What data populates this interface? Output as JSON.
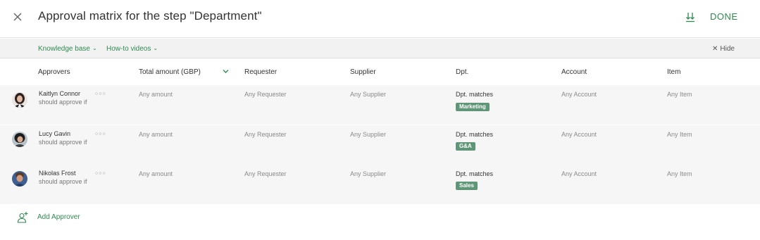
{
  "header": {
    "title": "Approval matrix for the step \"Department\"",
    "done_label": "DONE"
  },
  "helpbar": {
    "knowledge_base": "Knowledge base",
    "howto_videos": "How-to videos",
    "hide_label": "Hide"
  },
  "columns": [
    "Approvers",
    "Total amount (GBP)",
    "Requester",
    "Supplier",
    "Dpt.",
    "Account",
    "Item"
  ],
  "rows": [
    {
      "name": "Kaitlyn Connor",
      "sub": "should approve if",
      "amount": "Any amount",
      "requester": "Any Requester",
      "supplier": "Any Supplier",
      "dpt": "Dpt. matches",
      "tag": "Marketing",
      "account": "Any Account",
      "item": "Any Item"
    },
    {
      "name": "Lucy Gavin",
      "sub": "should approve if",
      "amount": "Any amount",
      "requester": "Any Requester",
      "supplier": "Any Supplier",
      "dpt": "Dpt. matches",
      "tag": "G&A",
      "account": "Any Account",
      "item": "Any Item"
    },
    {
      "name": "Nikolas Frost",
      "sub": "should approve if",
      "amount": "Any amount",
      "requester": "Any Requester",
      "supplier": "Any Supplier",
      "dpt": "Dpt. matches",
      "tag": "Sales",
      "account": "Any Account",
      "item": "Any Item"
    }
  ],
  "footer": {
    "add_approver_label": "Add Approver"
  },
  "colors": {
    "accent_green": "#2e8a4f",
    "tag_green": "#5f9677",
    "row_shade": "#f6f6f6"
  }
}
